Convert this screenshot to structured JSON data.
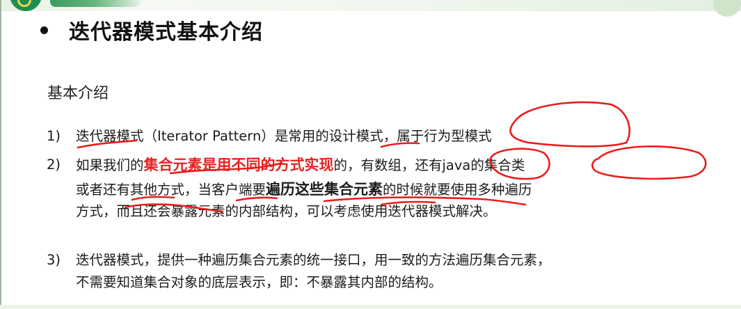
{
  "slide": {
    "title": "迭代器模式基本介绍",
    "subheading": "基本介绍",
    "items": [
      {
        "number": "1)",
        "line1": "迭代器模式（Iterator Pattern）是常用的设计模式，属于行为型模式"
      },
      {
        "number": "2)",
        "line1_prefix": "如果我们的",
        "line1_highlight": "集合元素是用不同的方式实现",
        "line1_suffix": "的，有数组，还有java的集合类",
        "line2_prefix": "或者还有其他方式，当客户端要",
        "line2_bold": "遍历这些集合元素",
        "line2_suffix": "的时候就要使用多种遍历",
        "line3": "方式，而且还会暴露元素的内部结构，可以考虑使用迭代器模式解决。"
      },
      {
        "number": "3)",
        "line1": "迭代器模式，提供一种遍历集合元素的统一接口，用一致的方法遍历集合元素，",
        "line2": "不需要知道集合对象的底层表示，即：不暴露其内部的结构。"
      }
    ]
  },
  "colors": {
    "highlight_text": "#e42323",
    "annotation_ink": "#ea1c1c",
    "brand_green": "#1d8f51"
  }
}
